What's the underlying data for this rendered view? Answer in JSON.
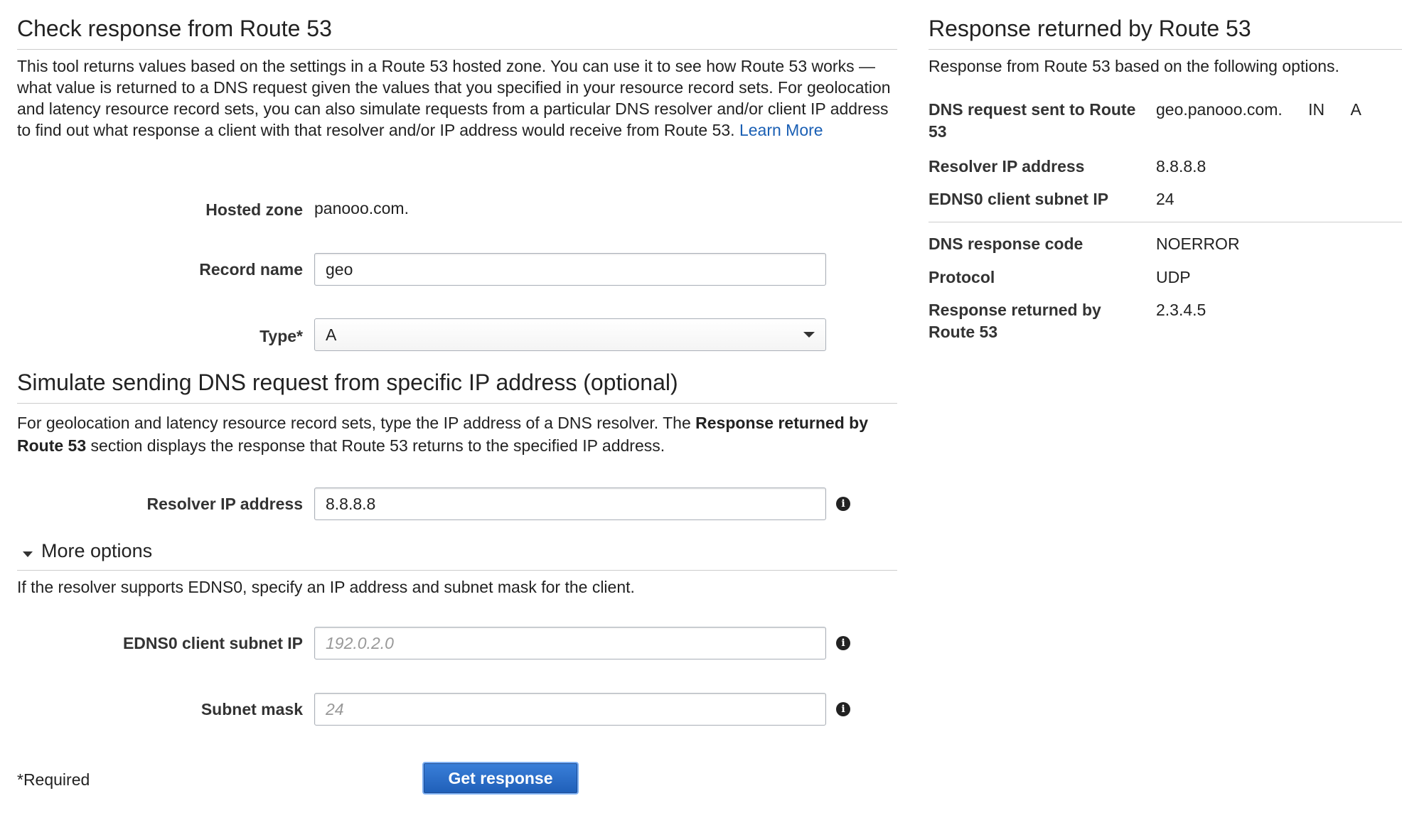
{
  "check": {
    "title": "Check response from Route 53",
    "description": "This tool returns values based on the settings in a Route 53 hosted zone. You can use it to see how Route 53 works — what value is returned to a DNS request given the values that you specified in your resource record sets. For geolocation and latency resource record sets, you can also simulate requests from a particular DNS resolver and/or client IP address to find out what response a client with that resolver and/or IP address would receive from Route 53.",
    "learn_more": "Learn More",
    "hosted_zone_label": "Hosted zone",
    "hosted_zone_value": "panooo.com.",
    "record_name_label": "Record name",
    "record_name_value": "geo",
    "type_label": "Type*",
    "type_value": "A"
  },
  "simulate": {
    "title": "Simulate sending DNS request from specific IP address (optional)",
    "desc_part1": "For geolocation and latency resource record sets, type the IP address of a DNS resolver. The ",
    "desc_bold": "Response returned by Route 53",
    "desc_part2": " section displays the response that Route 53 returns to the specified IP address.",
    "resolver_label": "Resolver IP address",
    "resolver_value": "8.8.8.8"
  },
  "more_options": {
    "label": "More options",
    "description": "If the resolver supports EDNS0, specify an IP address and subnet mask for the client.",
    "edns_label": "EDNS0 client subnet IP",
    "edns_placeholder": "192.0.2.0",
    "subnet_label": "Subnet mask",
    "subnet_placeholder": "24"
  },
  "footer": {
    "required_note": "*Required",
    "get_response_button": "Get response"
  },
  "response": {
    "title": "Response returned by Route 53",
    "subtitle": "Response from Route 53 based on the following options.",
    "dns_request_label": "DNS request sent to Route 53",
    "dns_request_name": "geo.panooo.com.",
    "dns_request_class": "IN",
    "dns_request_type": "A",
    "resolver_label": "Resolver IP address",
    "resolver_value": "8.8.8.8",
    "edns_label": "EDNS0 client subnet IP",
    "edns_value": "24",
    "response_code_label": "DNS response code",
    "response_code_value": "NOERROR",
    "protocol_label": "Protocol",
    "protocol_value": "UDP",
    "returned_label": "Response returned by Route 53",
    "returned_value": "2.3.4.5"
  },
  "colors": {
    "link": "#1a5fb4",
    "button": "#2a6fcf",
    "divider": "#cccccc"
  }
}
